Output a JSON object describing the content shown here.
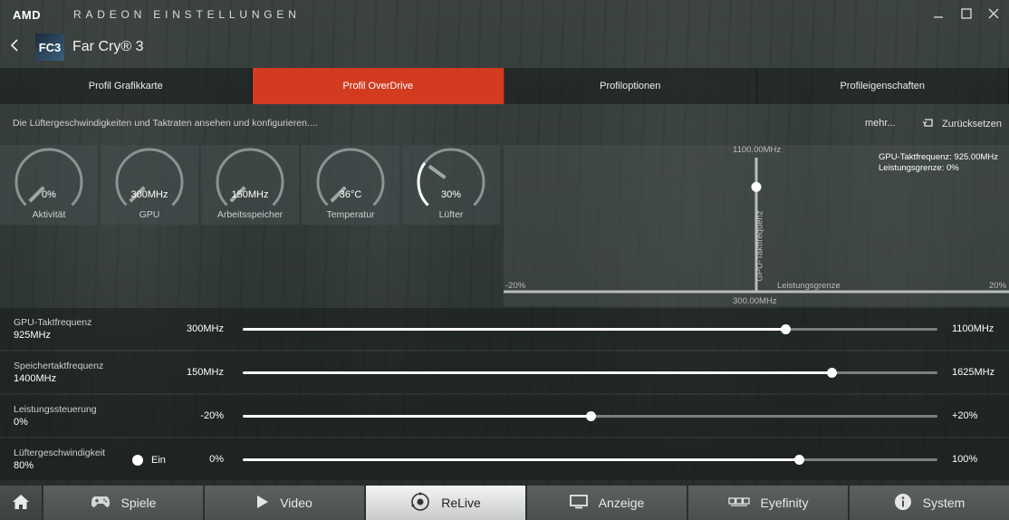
{
  "titlebar": {
    "brand": "AMD",
    "app_title": "RADEON EINSTELLUNGEN",
    "minimize_icon": "minimize-icon",
    "maximize_icon": "maximize-icon",
    "close_icon": "close-icon"
  },
  "header": {
    "back_icon": "chevron-left-icon",
    "game_icon_text": "FC3",
    "game_title": "Far Cry® 3"
  },
  "tabs": [
    {
      "label": "Profil Grafikkarte",
      "active": false
    },
    {
      "label": "Profil OverDrive",
      "active": true
    },
    {
      "label": "Profiloptionen",
      "active": false
    },
    {
      "label": "Profileigenschaften",
      "active": false
    }
  ],
  "description": {
    "text": "Die Lüftergeschwindigkeiten und Taktraten ansehen und konfigurieren....",
    "more": "mehr...",
    "reset": "Zurücksetzen"
  },
  "gauges": [
    {
      "value": "0%",
      "label": "Aktivität",
      "level": 0.0
    },
    {
      "value": "300MHz",
      "label": "GPU",
      "level": 0.0
    },
    {
      "value": "150MHz",
      "label": "Arbeitsspeicher",
      "level": 0.0
    },
    {
      "value": "36°C",
      "label": "Temperatur",
      "level": 0.0
    },
    {
      "value": "30%",
      "label": "Lüfter",
      "level": 0.3
    }
  ],
  "chart_data": {
    "type": "scatter",
    "x_axis_label": "Leistungsgrenze",
    "y_axis_label": "GPU-Taktfrequenz",
    "x_min_label": "-20%",
    "x_max_label": "20%",
    "y_max_label": "1100.00MHz",
    "y_min_label": "300.00MHz",
    "xlim": [
      -20,
      20
    ],
    "ylim": [
      300,
      1100
    ],
    "point": {
      "x": 0,
      "y": 925
    },
    "readout_freq": "GPU-Taktfrequenz: 925.00MHz",
    "readout_limit": "Leistungsgrenze: 0%"
  },
  "sliders": [
    {
      "name": "GPU-Taktfrequenz",
      "value": "925MHz",
      "min": "300MHz",
      "max": "1100MHz",
      "fraction": 0.781
    },
    {
      "name": "Speichertaktfrequenz",
      "value": "1400MHz",
      "min": "150MHz",
      "max": "1625MHz",
      "fraction": 0.847
    },
    {
      "name": "Leistungssteuerung",
      "value": "0%",
      "min": "-20%",
      "max": "+20%",
      "fraction": 0.5
    },
    {
      "name": "Lüftergeschwindigkeit",
      "value": "80%",
      "min": "0%",
      "max": "100%",
      "fraction": 0.8,
      "toggle": "Ein"
    }
  ],
  "nav": [
    {
      "label": "",
      "icon": "home-icon",
      "active": false
    },
    {
      "label": "Spiele",
      "icon": "gamepad-icon",
      "active": false
    },
    {
      "label": "Video",
      "icon": "play-icon",
      "active": false
    },
    {
      "label": "ReLive",
      "icon": "relive-icon",
      "active": true
    },
    {
      "label": "Anzeige",
      "icon": "monitor-icon",
      "active": false
    },
    {
      "label": "Eyefinity",
      "icon": "eyefinity-icon",
      "active": false
    },
    {
      "label": "System",
      "icon": "info-icon",
      "active": false
    }
  ]
}
